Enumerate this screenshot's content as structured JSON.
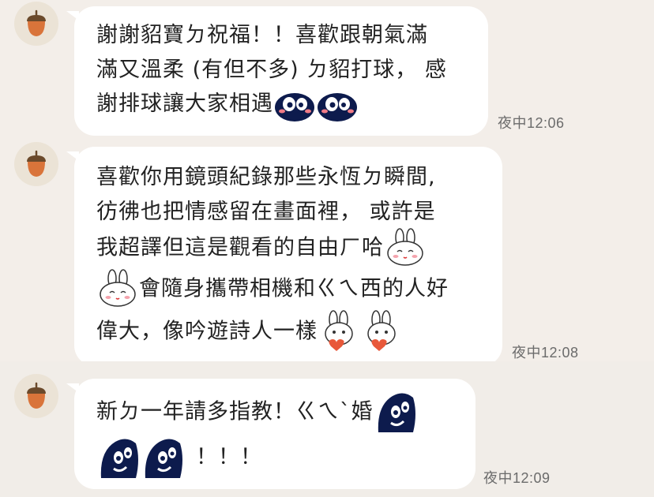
{
  "messages": [
    {
      "lines": [
        "謝謝貂寶ㄉ祝福！！喜歡跟朝氣滿",
        "滿又溫柔 (有但不多) ㄉ貂打球， 感",
        "謝排球讓大家相遇"
      ],
      "time": "夜中12:06"
    },
    {
      "lines": [
        "喜歡你用鏡頭紀錄那些永恆ㄉ瞬間,",
        "彷彿也把情感留在畫面裡， 或許是",
        "我超譯但這是觀看的自由ㄏ哈",
        "會隨身攜帶相機和ㄍㄟ西的人好",
        "偉大，像吟遊詩人一樣"
      ],
      "time": "夜中12:08"
    },
    {
      "lines": [
        "新ㄉ一年請多指教！ㄍㄟˋ婚",
        "！！！"
      ],
      "time": "夜中12:09"
    }
  ],
  "colors": {
    "background": "#f3eee9",
    "bubble": "#ffffff",
    "text": "#222222",
    "time": "#6b6b6b",
    "acorn": "#d9743a"
  },
  "icons": {
    "avatar": "acorn-icon",
    "sticker_penguin": "penguin-sticker",
    "sticker_bunny": "bunny-sticker",
    "sticker_bunny_heart": "bunny-heart-sticker"
  }
}
